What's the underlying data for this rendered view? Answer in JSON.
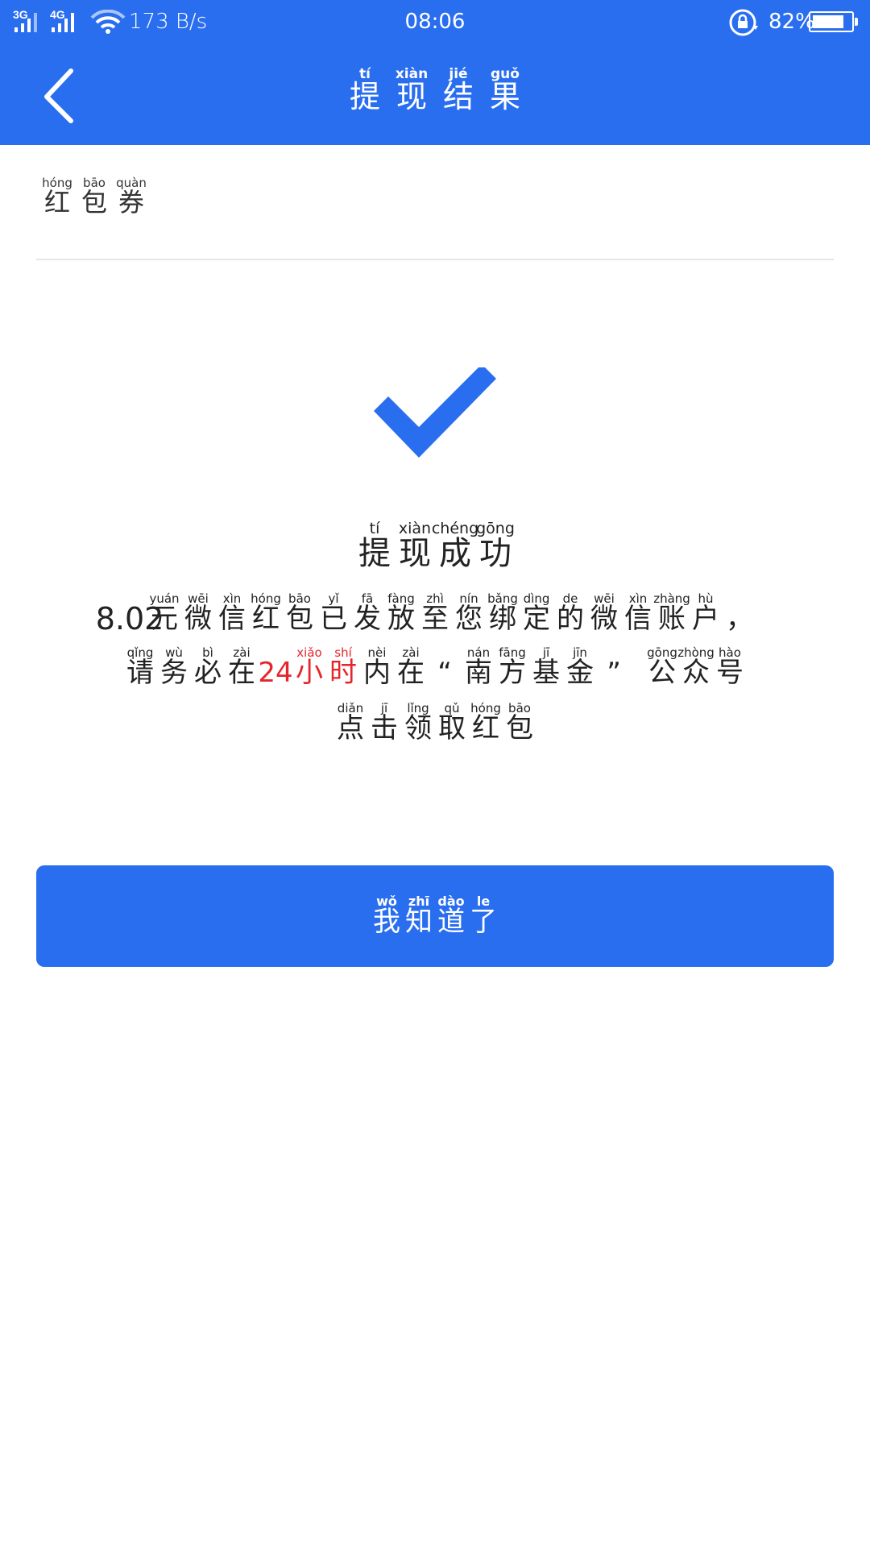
{
  "status_bar": {
    "net_1": "3G",
    "net_2": "4G",
    "speed": "173 B/s",
    "time": "08:06",
    "battery": "82%",
    "battery_level": 0.82
  },
  "header": {
    "back_icon": "chevron-left-icon",
    "title": [
      {
        "py": "tí",
        "hz": "提"
      },
      {
        "py": "xiàn",
        "hz": "现"
      },
      {
        "py": "jié",
        "hz": "结"
      },
      {
        "py": "guǒ",
        "hz": "果"
      }
    ]
  },
  "section": {
    "label": [
      {
        "py": "hóng",
        "hz": "红"
      },
      {
        "py": "bāo",
        "hz": "包"
      },
      {
        "py": "quàn",
        "hz": "券"
      }
    ]
  },
  "result": {
    "icon": "checkmark-icon",
    "title": [
      {
        "py": "tí",
        "hz": "提"
      },
      {
        "py": "xiàn",
        "hz": "现"
      },
      {
        "py": "chéng",
        "hz": "成"
      },
      {
        "py": "gōng",
        "hz": "功"
      }
    ],
    "amount": "8.02",
    "line1": [
      {
        "py": "yuán",
        "hz": "元"
      },
      {
        "py": "wēi",
        "hz": "微"
      },
      {
        "py": "xìn",
        "hz": "信"
      },
      {
        "py": "hóng",
        "hz": "红"
      },
      {
        "py": "bāo",
        "hz": "包"
      },
      {
        "py": "yǐ",
        "hz": "已"
      },
      {
        "py": "fā",
        "hz": "发"
      },
      {
        "py": "fàng",
        "hz": "放"
      },
      {
        "py": "zhì",
        "hz": "至"
      },
      {
        "py": "nín",
        "hz": "您"
      },
      {
        "py": "bǎng",
        "hz": "绑"
      },
      {
        "py": "dìng",
        "hz": "定"
      },
      {
        "py": "de",
        "hz": "的"
      },
      {
        "py": "wēi",
        "hz": "微"
      },
      {
        "py": "xìn",
        "hz": "信"
      },
      {
        "py": "zhàng",
        "hz": "账"
      },
      {
        "py": "hù",
        "hz": "户"
      },
      {
        "py": "",
        "hz": "，"
      }
    ],
    "line2_a": [
      {
        "py": "qǐng",
        "hz": "请"
      },
      {
        "py": "wù",
        "hz": "务"
      },
      {
        "py": "bì",
        "hz": "必"
      },
      {
        "py": "zài",
        "hz": "在"
      }
    ],
    "line2_num": "24",
    "line2_red": [
      {
        "py": "xiǎo",
        "hz": "小"
      },
      {
        "py": "shí",
        "hz": "时"
      }
    ],
    "line2_b": [
      {
        "py": "nèi",
        "hz": "内"
      },
      {
        "py": "zài",
        "hz": "在"
      }
    ],
    "quote_open": "“",
    "line2_q": [
      {
        "py": "nán",
        "hz": "南"
      },
      {
        "py": "fāng",
        "hz": "方"
      },
      {
        "py": "jī",
        "hz": "基"
      },
      {
        "py": "jīn",
        "hz": "金"
      }
    ],
    "quote_close": "”",
    "line2_c": [
      {
        "py": "gōng",
        "hz": "公"
      },
      {
        "py": "zhòng",
        "hz": "众"
      },
      {
        "py": "hào",
        "hz": "号"
      }
    ],
    "line3": [
      {
        "py": "diǎn",
        "hz": "点"
      },
      {
        "py": "jī",
        "hz": "击"
      },
      {
        "py": "lǐng",
        "hz": "领"
      },
      {
        "py": "qǔ",
        "hz": "取"
      },
      {
        "py": "hóng",
        "hz": "红"
      },
      {
        "py": "bāo",
        "hz": "包"
      }
    ]
  },
  "confirm": {
    "label": [
      {
        "py": "wǒ",
        "hz": "我"
      },
      {
        "py": "zhī",
        "hz": "知"
      },
      {
        "py": "dào",
        "hz": "道"
      },
      {
        "py": "le",
        "hz": "了"
      }
    ]
  }
}
